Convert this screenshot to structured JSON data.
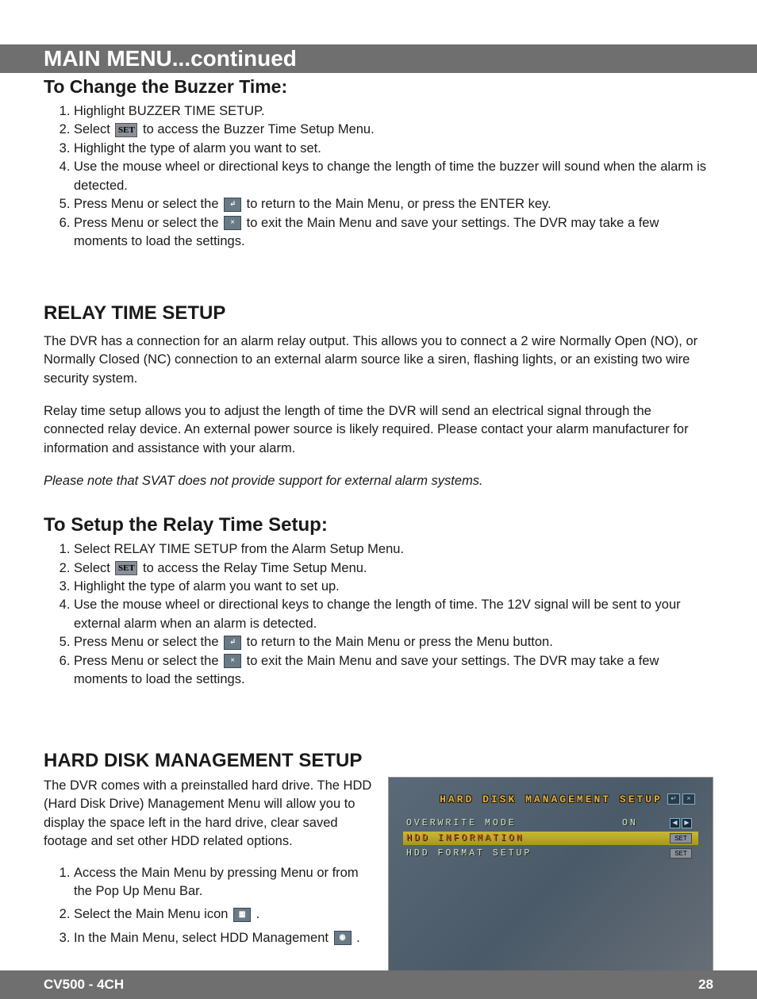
{
  "header": {
    "title": "MAIN MENU...continued"
  },
  "section1": {
    "title": "To Change the Buzzer Time:",
    "steps": [
      {
        "pre": "Highlight BUZZER TIME SETUP."
      },
      {
        "pre": "Select ",
        "icon": "SET",
        "post": " to access the Buzzer Time Setup Menu."
      },
      {
        "pre": "Highlight the type of alarm you want to set."
      },
      {
        "pre": "Use the mouse wheel or directional keys to change the length of time the buzzer will sound when the alarm is detected."
      },
      {
        "pre": "Press Menu or select the ",
        "icon": "↵",
        "post": " to return to the Main Menu, or press the ENTER key."
      },
      {
        "pre": "Press Menu or select the ",
        "icon": "×",
        "post": " to exit the Main Menu and save your settings. The DVR may take a few moments to load the settings."
      }
    ]
  },
  "section2": {
    "title": "RELAY TIME SETUP",
    "para1": "The DVR has a connection for an alarm relay output. This allows you to connect a 2 wire Normally Open (NO), or Normally Closed (NC) connection to an external alarm source like a siren, flashing lights, or an existing two wire security system.",
    "para2": "Relay time setup allows you to adjust the length of time the DVR will send an electrical signal through the connected relay device. An external power source is likely required. Please contact your alarm manufacturer for information and assistance with your alarm.",
    "note": "Please note that SVAT does not provide support for external alarm systems."
  },
  "section3": {
    "title": "To Setup the Relay Time Setup:",
    "steps": [
      {
        "pre": "Select RELAY TIME SETUP from the Alarm Setup Menu."
      },
      {
        "pre": "Select ",
        "icon": "SET",
        "post": "  to access the Relay Time Setup Menu."
      },
      {
        "pre": "Highlight the type of alarm you want to set up."
      },
      {
        "pre": "Use the mouse wheel or directional keys to change the length of time. The 12V signal will be sent to your external alarm when an alarm is detected."
      },
      {
        "pre": "Press Menu or select the ",
        "icon": "↵",
        "post": " to return to the Main Menu or press the Menu button."
      },
      {
        "pre": "Press Menu or select the ",
        "icon": "×",
        "post": " to exit the Main Menu and save your settings. The DVR may take a few moments to load the settings."
      }
    ]
  },
  "section4": {
    "title": "HARD DISK MANAGEMENT SETUP",
    "intro": "The DVR comes with a preinstalled hard drive. The HDD (Hard Disk Drive) Management Menu will allow you to display the space left in the hard drive, clear saved footage and set other HDD related options.",
    "steps": [
      {
        "pre": "Access the Main Menu by pressing Menu or from the Pop Up Menu Bar."
      },
      {
        "pre": "Select the Main Menu icon ",
        "icon": "▦",
        "post": " ."
      },
      {
        "pre": "In the Main Menu, select HDD Management ",
        "icon": "◉",
        "post": " ."
      }
    ]
  },
  "dvr": {
    "title": "HARD DISK MANAGEMENT SETUP",
    "back": "↵",
    "close": "×",
    "rows": [
      {
        "label": "OVERWRITE MODE",
        "val": "ON",
        "ctrl": "arrows"
      },
      {
        "label": "HDD INFORMATION",
        "val": "",
        "ctrl": "set",
        "highlight": true
      },
      {
        "label": "HDD FORMAT SETUP",
        "val": "",
        "ctrl": "set"
      }
    ],
    "set_label": "SET",
    "arrow_left": "◀",
    "arrow_right": "▶"
  },
  "footer": {
    "model": "CV500 - 4CH",
    "page": "28"
  }
}
